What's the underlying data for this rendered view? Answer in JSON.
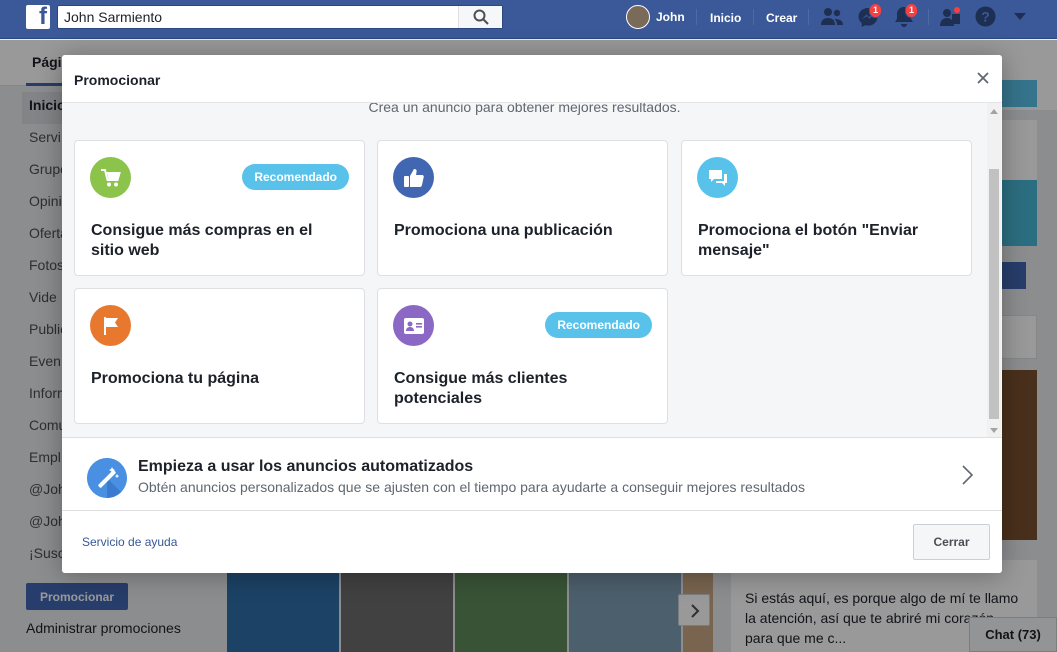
{
  "topbar": {
    "search_value": "John Sarmiento",
    "profile_name": "John",
    "home": "Inicio",
    "create": "Crear",
    "messages_badge": "1",
    "notifications_badge": "1"
  },
  "page": {
    "tab_partial": "Pági",
    "right_partial": "a",
    "leftnav": [
      "Inicio",
      "Servi",
      "Grupo",
      "Opini",
      "Oferta",
      "Fotos",
      "Vide",
      "Public",
      "Even",
      "Inform",
      "Comu",
      "Empl",
      "@Joh",
      "@Joh",
      "¡Susc"
    ],
    "promote_button": "Promocionar",
    "manage_promotions": "Administrar promociones",
    "right_text": "Si estás aquí, es porque algo de mí te llamo la atención, así que te abriré mi corazón para que me c...",
    "chat": "Chat (73)"
  },
  "modal": {
    "title": "Promocionar",
    "subtitle": "Crea un anuncio para obtener mejores resultados.",
    "cards": [
      {
        "title": "Consigue más compras en el sitio web",
        "badge": "Recomendado",
        "color": "#8cc34a",
        "icon": "cart-icon"
      },
      {
        "title": "Promociona una publicación",
        "badge": "",
        "color": "#4267b2",
        "icon": "thumbs-up-icon"
      },
      {
        "title": "Promociona el botón \"Enviar mensaje\"",
        "badge": "",
        "color": "#59c2ea",
        "icon": "chat-bubbles-icon"
      },
      {
        "title": "Promociona tu página",
        "badge": "",
        "color": "#e8782d",
        "icon": "flag-icon"
      },
      {
        "title": "Consigue más clientes potenciales",
        "badge": "Recomendado",
        "color": "#8b68c4",
        "icon": "contact-card-icon"
      }
    ],
    "automated": {
      "title": "Empieza a usar los anuncios automatizados",
      "description": "Obtén anuncios personalizados que se ajusten con el tiempo para ayudarte a conseguir mejores resultados"
    },
    "help_link": "Servicio de ayuda",
    "close_button": "Cerrar"
  }
}
